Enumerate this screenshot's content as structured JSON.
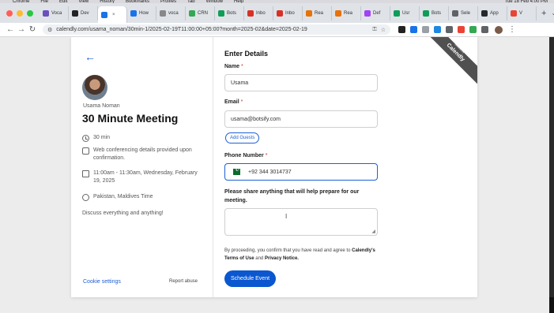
{
  "menubar": {
    "items": [
      "Chrome",
      "File",
      "Edit",
      "View",
      "History",
      "Bookmarks",
      "Profiles",
      "Tab",
      "Window",
      "Help"
    ],
    "clock": "Tue 18 Feb 4:00 PM"
  },
  "tabs": [
    {
      "label": "Voca",
      "color": "#6b4fbb"
    },
    {
      "label": "Dev",
      "color": "#222222",
      "active": false
    },
    {
      "label": "",
      "color": "#1a73e8",
      "active": true
    },
    {
      "label": "How",
      "color": "#1a73e8"
    },
    {
      "label": "voca",
      "color": "#888888"
    },
    {
      "label": "CRN",
      "color": "#34a853"
    },
    {
      "label": "Bots",
      "color": "#0f9d58"
    },
    {
      "label": "Inbo",
      "color": "#d93025"
    },
    {
      "label": "Inbo",
      "color": "#d93025"
    },
    {
      "label": "Rea",
      "color": "#e8710a"
    },
    {
      "label": "Rea",
      "color": "#e8710a"
    },
    {
      "label": "Def",
      "color": "#a142f4"
    },
    {
      "label": "Usr",
      "color": "#0f9d58"
    },
    {
      "label": "Bots",
      "color": "#0f9d58"
    },
    {
      "label": "Sele",
      "color": "#5f6368"
    },
    {
      "label": "App",
      "color": "#24292f"
    },
    {
      "label": "V",
      "color": "#ea4335"
    }
  ],
  "address": {
    "url": "calendly.com/usama_noman/30min-1/2025-02-19T11:00:00+05:00?month=2025-02&date=2025-02-19"
  },
  "event": {
    "host": "Usama Noman",
    "title": "30 Minute Meeting",
    "duration": "30 min",
    "conferencing": "Web conferencing details provided upon confirmation.",
    "time": "11:00am - 11:30am, Wednesday, February 19, 2025",
    "timezone": "Pakistan, Maldives Time",
    "description": "Discuss everything and anything!",
    "cookie": "Cookie settings",
    "report": "Report abuse"
  },
  "form": {
    "heading": "Enter Details",
    "name_label": "Name",
    "name_value": "Usama",
    "email_label": "Email",
    "email_value": "usama@botsify.com",
    "add_guests": "Add Guests",
    "phone_label": "Phone Number",
    "phone_value": "+92 344 3014737",
    "share_label": "Please share anything that will help prepare for our meeting.",
    "terms_prefix": "By proceeding, you confirm that you have read and agree to",
    "terms_link": "Calendly's Terms of Use",
    "terms_and": "and",
    "privacy_link": "Privacy Notice.",
    "submit": "Schedule Event",
    "required_mark": "*"
  },
  "ribbon": {
    "small": "powered by",
    "brand": "Calendly"
  },
  "colors": {
    "accent": "#0b57d0",
    "link": "#1f5fd6",
    "ribbon": "#505050"
  }
}
